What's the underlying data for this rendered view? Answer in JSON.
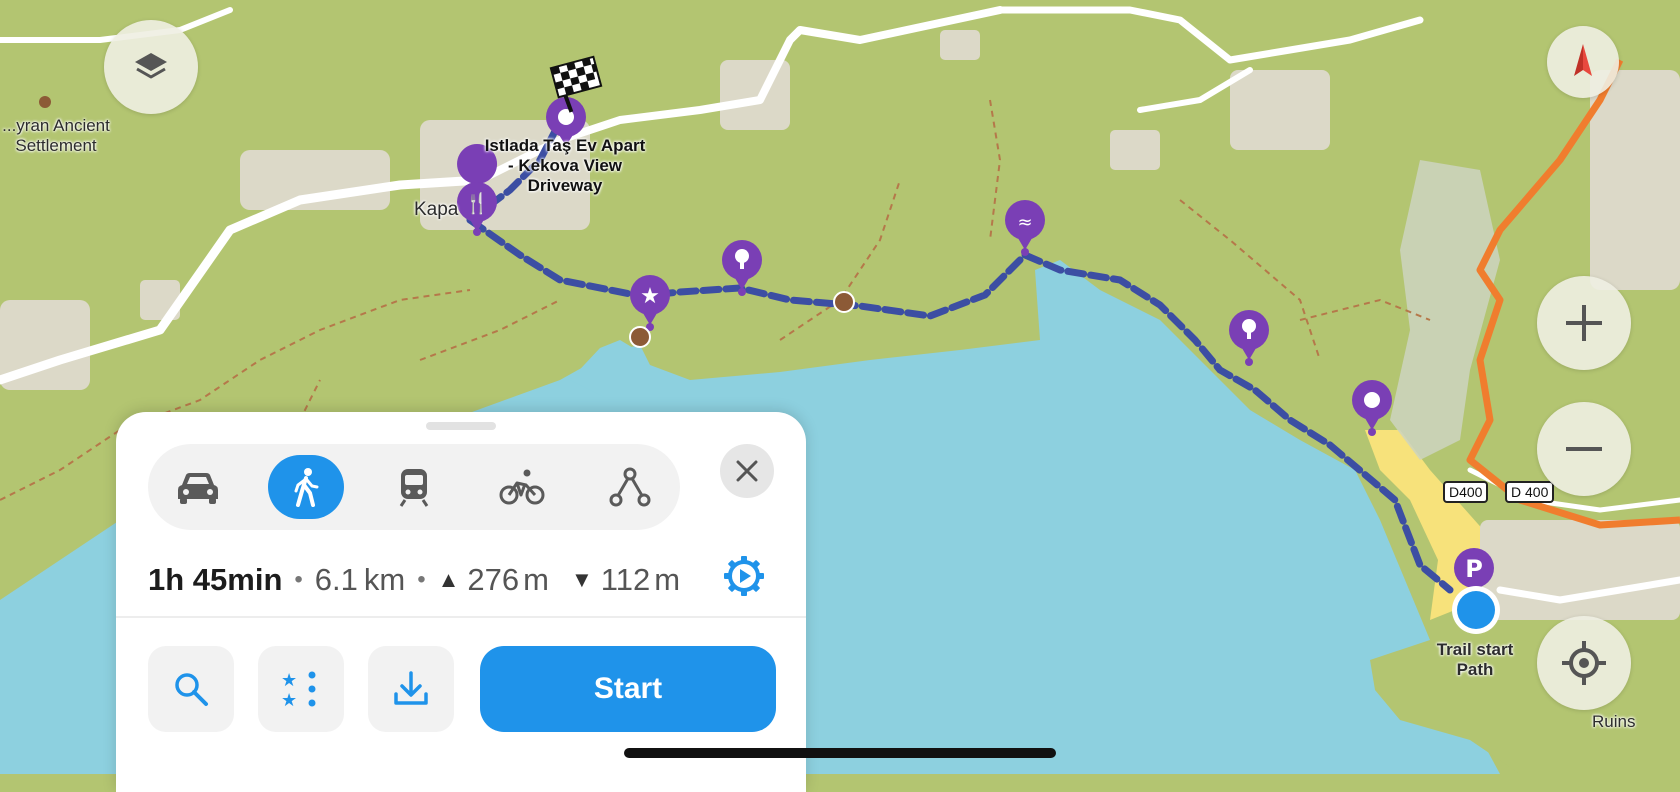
{
  "map": {
    "labels": {
      "ancient_settlement": "...yran Ancient\nSettlement",
      "kapa": "Kapa",
      "destination": "Istlada Taş Ev Apart\n- Kekova View\nDriveway",
      "trail_start": "Trail start\nPath",
      "ruins": "Ruins"
    },
    "road_shields": [
      "D400",
      "D 400"
    ],
    "colors": {
      "land": "#b3c571",
      "water": "#8dd0df",
      "route": "#3c4ea3",
      "poi": "#7a3fb5",
      "highway": "#f07d2e",
      "beach": "#f7e27b",
      "accent": "#1f93ea"
    }
  },
  "controls": {
    "layers_icon": "layers-icon",
    "compass_icon": "compass-icon",
    "zoom_in_icon": "plus-icon",
    "zoom_out_icon": "minus-icon",
    "locate_icon": "target-icon"
  },
  "route_panel": {
    "modes": [
      {
        "name": "car",
        "icon": "car-icon",
        "active": false
      },
      {
        "name": "walk",
        "icon": "pedestrian-icon",
        "active": true
      },
      {
        "name": "transit",
        "icon": "train-icon",
        "active": false
      },
      {
        "name": "bike",
        "icon": "bicycle-icon",
        "active": false
      },
      {
        "name": "custom",
        "icon": "nodes-icon",
        "active": false
      }
    ],
    "duration": "1h 45min",
    "distance_value": "6.1",
    "distance_unit": "km",
    "ascent_value": "276",
    "ascent_unit": "m",
    "descent_value": "112",
    "descent_unit": "m",
    "start_label": "Start"
  }
}
